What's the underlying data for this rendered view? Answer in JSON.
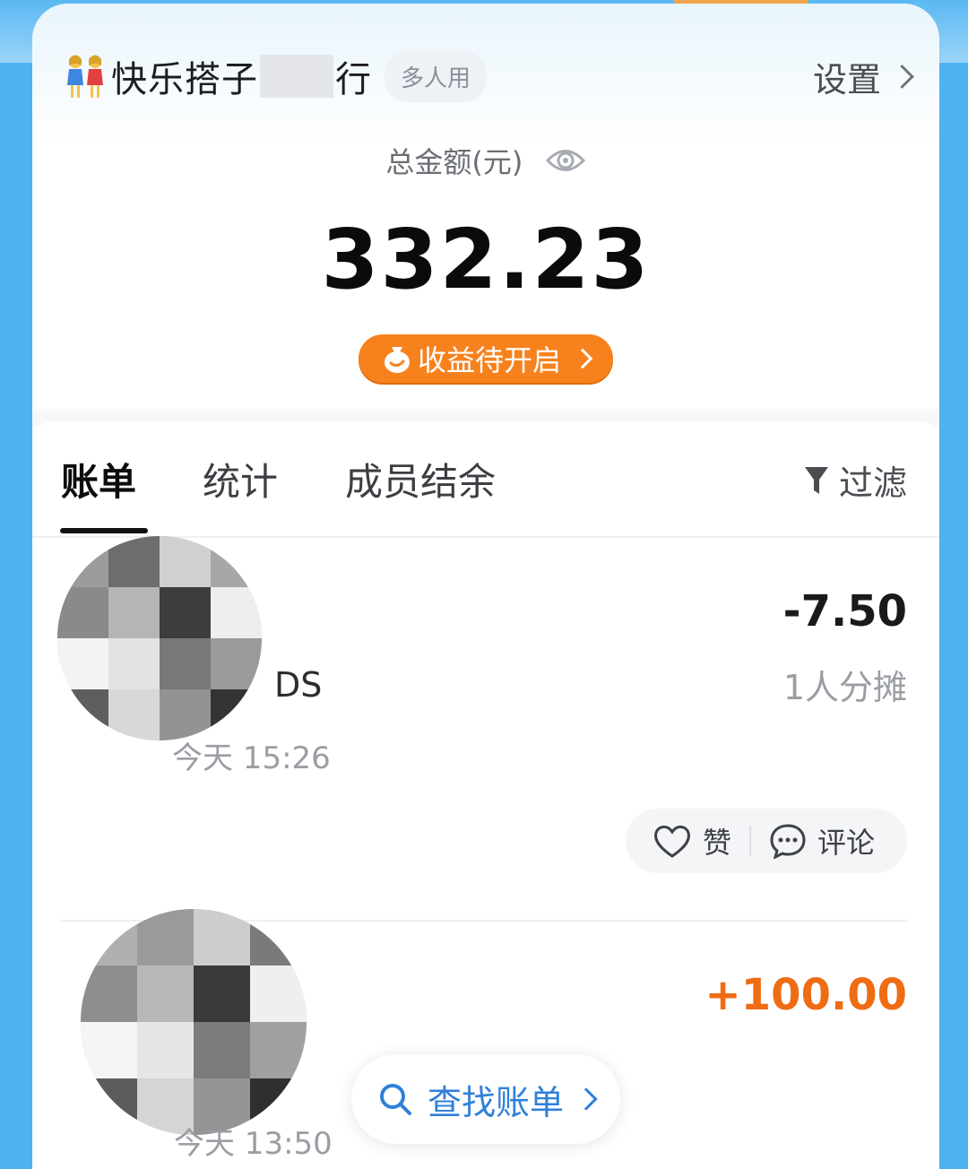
{
  "header": {
    "title_prefix": "快乐搭子",
    "title_suffix": "行",
    "badge": "多人用",
    "settings_label": "设置"
  },
  "summary": {
    "total_label": "总金额(元)",
    "total_amount": "332.23",
    "earnings_button": "收益待开启"
  },
  "tabs": [
    {
      "label": "账单",
      "active": true
    },
    {
      "label": "统计",
      "active": false
    },
    {
      "label": "成员结余",
      "active": false
    }
  ],
  "filter_label": "过滤",
  "transactions": [
    {
      "merchant_visible": "DS",
      "time": "今天 15:26",
      "amount": "-7.50",
      "split_info": "1人分摊",
      "like_label": "赞",
      "comment_label": "评论"
    },
    {
      "time": "今天 13:50",
      "amount": "+100.00"
    }
  ],
  "search_button": "查找账单",
  "colors": {
    "accent_orange": "#f7821d",
    "income_orange": "#ef6c15",
    "link_blue": "#2f80d9",
    "sky_blue": "#4fb2f0"
  }
}
